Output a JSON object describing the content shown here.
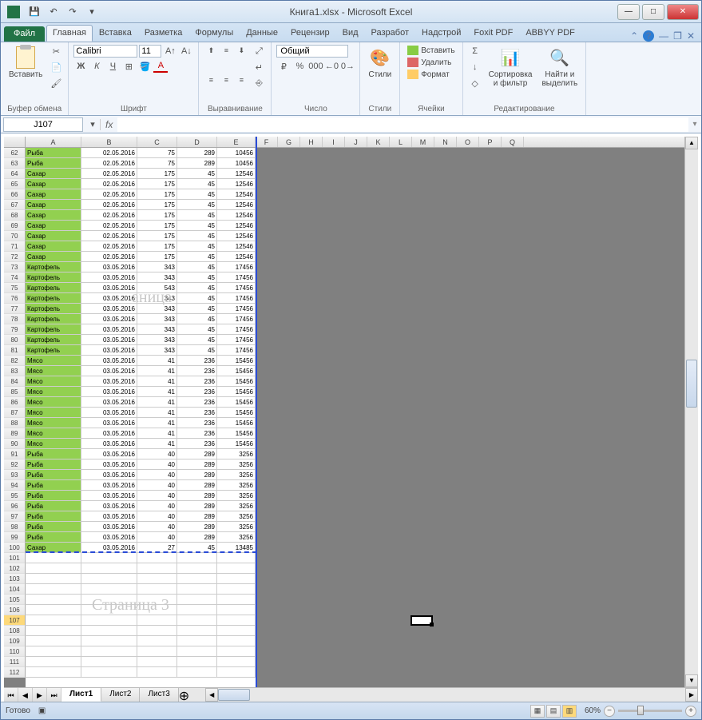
{
  "title": "Книга1.xlsx - Microsoft Excel",
  "qat": {
    "save": "💾",
    "undo": "↶",
    "redo": "↷",
    "more": "▾"
  },
  "win": {
    "min": "—",
    "max": "□",
    "close": "✕"
  },
  "tabs": {
    "file": "Файл",
    "list": [
      "Главная",
      "Вставка",
      "Разметка",
      "Формулы",
      "Данные",
      "Рецензир",
      "Вид",
      "Разработ",
      "Надстрой",
      "Foxit PDF",
      "ABBYY PDF"
    ],
    "active": "Главная"
  },
  "ribbon": {
    "clipboard": {
      "label": "Буфер обмена",
      "paste": "Вставить",
      "cut": "✂",
      "copy": "📄",
      "brush": "🖌"
    },
    "font": {
      "label": "Шрифт",
      "name": "Calibri",
      "size": "11",
      "bold": "Ж",
      "italic": "К",
      "underline": "Ч",
      "border": "⊞",
      "fill": "🪣",
      "color": "A",
      "grow": "A↑",
      "shrink": "A↓"
    },
    "align": {
      "label": "Выравнивание",
      "wrap": "↵",
      "merge": "⎆"
    },
    "number": {
      "label": "Число",
      "format": "Общий",
      "currency": "₽",
      "percent": "%",
      "comma": "000",
      "inc": "←0",
      "dec": "0→"
    },
    "styles": {
      "label": "Стили",
      "btn": "Стили"
    },
    "cells": {
      "label": "Ячейки",
      "insert": "Вставить",
      "delete": "Удалить",
      "format": "Формат"
    },
    "editing": {
      "label": "Редактирование",
      "sum": "Σ",
      "fill": "↓",
      "clear": "◇",
      "sort": "Сортировка\nи фильтр",
      "find": "Найти и\nвыделить"
    }
  },
  "namebox": "J107",
  "fx": "fx",
  "columns": [
    "A",
    "B",
    "C",
    "D",
    "E",
    "F",
    "G",
    "H",
    "I",
    "J",
    "K",
    "L",
    "M",
    "N",
    "O",
    "P",
    "Q"
  ],
  "watermarks": {
    "p2": "аница",
    "p3": "Страница 3"
  },
  "data_rows": [
    {
      "r": 62,
      "a": "Рыба",
      "b": "02.05.2016",
      "c": 75,
      "d": 289,
      "e": 10456
    },
    {
      "r": 63,
      "a": "Рыба",
      "b": "02.05.2016",
      "c": 75,
      "d": 289,
      "e": 10456
    },
    {
      "r": 64,
      "a": "Сахар",
      "b": "02.05.2016",
      "c": 175,
      "d": 45,
      "e": 12546
    },
    {
      "r": 65,
      "a": "Сахар",
      "b": "02.05.2016",
      "c": 175,
      "d": 45,
      "e": 12546
    },
    {
      "r": 66,
      "a": "Сахар",
      "b": "02.05.2016",
      "c": 175,
      "d": 45,
      "e": 12546
    },
    {
      "r": 67,
      "a": "Сахар",
      "b": "02.05.2016",
      "c": 175,
      "d": 45,
      "e": 12546
    },
    {
      "r": 68,
      "a": "Сахар",
      "b": "02.05.2016",
      "c": 175,
      "d": 45,
      "e": 12546
    },
    {
      "r": 69,
      "a": "Сахар",
      "b": "02.05.2016",
      "c": 175,
      "d": 45,
      "e": 12546
    },
    {
      "r": 70,
      "a": "Сахар",
      "b": "02.05.2016",
      "c": 175,
      "d": 45,
      "e": 12546
    },
    {
      "r": 71,
      "a": "Сахар",
      "b": "02.05.2016",
      "c": 175,
      "d": 45,
      "e": 12546
    },
    {
      "r": 72,
      "a": "Сахар",
      "b": "02.05.2016",
      "c": 175,
      "d": 45,
      "e": 12546
    },
    {
      "r": 73,
      "a": "Картофель",
      "b": "03.05.2016",
      "c": 343,
      "d": 45,
      "e": 17456
    },
    {
      "r": 74,
      "a": "Картофель",
      "b": "03.05.2016",
      "c": 343,
      "d": 45,
      "e": 17456
    },
    {
      "r": 75,
      "a": "Картофель",
      "b": "03.05.2016",
      "c": 543,
      "d": 45,
      "e": 17456
    },
    {
      "r": 76,
      "a": "Картофель",
      "b": "03.05.2016",
      "c": 343,
      "d": 45,
      "e": 17456
    },
    {
      "r": 77,
      "a": "Картофель",
      "b": "03.05.2016",
      "c": 343,
      "d": 45,
      "e": 17456
    },
    {
      "r": 78,
      "a": "Картофель",
      "b": "03.05.2016",
      "c": 343,
      "d": 45,
      "e": 17456
    },
    {
      "r": 79,
      "a": "Картофель",
      "b": "03.05.2016",
      "c": 343,
      "d": 45,
      "e": 17456
    },
    {
      "r": 80,
      "a": "Картофель",
      "b": "03.05.2016",
      "c": 343,
      "d": 45,
      "e": 17456
    },
    {
      "r": 81,
      "a": "Картофель",
      "b": "03.05.2016",
      "c": 343,
      "d": 45,
      "e": 17456
    },
    {
      "r": 82,
      "a": "Мясо",
      "b": "03.05.2016",
      "c": 41,
      "d": 236,
      "e": 15456
    },
    {
      "r": 83,
      "a": "Мясо",
      "b": "03.05.2016",
      "c": 41,
      "d": 236,
      "e": 15456
    },
    {
      "r": 84,
      "a": "Мясо",
      "b": "03.05.2016",
      "c": 41,
      "d": 236,
      "e": 15456
    },
    {
      "r": 85,
      "a": "Мясо",
      "b": "03.05.2016",
      "c": 41,
      "d": 236,
      "e": 15456
    },
    {
      "r": 86,
      "a": "Мясо",
      "b": "03.05.2016",
      "c": 41,
      "d": 236,
      "e": 15456
    },
    {
      "r": 87,
      "a": "Мясо",
      "b": "03.05.2016",
      "c": 41,
      "d": 236,
      "e": 15456
    },
    {
      "r": 88,
      "a": "Мясо",
      "b": "03.05.2016",
      "c": 41,
      "d": 236,
      "e": 15456
    },
    {
      "r": 89,
      "a": "Мясо",
      "b": "03.05.2016",
      "c": 41,
      "d": 236,
      "e": 15456
    },
    {
      "r": 90,
      "a": "Мясо",
      "b": "03.05.2016",
      "c": 41,
      "d": 236,
      "e": 15456
    },
    {
      "r": 91,
      "a": "Рыба",
      "b": "03.05.2016",
      "c": 40,
      "d": 289,
      "e": 3256
    },
    {
      "r": 92,
      "a": "Рыба",
      "b": "03.05.2016",
      "c": 40,
      "d": 289,
      "e": 3256
    },
    {
      "r": 93,
      "a": "Рыба",
      "b": "03.05.2016",
      "c": 40,
      "d": 289,
      "e": 3256
    },
    {
      "r": 94,
      "a": "Рыба",
      "b": "03.05.2016",
      "c": 40,
      "d": 289,
      "e": 3256
    },
    {
      "r": 95,
      "a": "Рыба",
      "b": "03.05.2016",
      "c": 40,
      "d": 289,
      "e": 3256
    },
    {
      "r": 96,
      "a": "Рыба",
      "b": "03.05.2016",
      "c": 40,
      "d": 289,
      "e": 3256
    },
    {
      "r": 97,
      "a": "Рыба",
      "b": "03.05.2016",
      "c": 40,
      "d": 289,
      "e": 3256
    },
    {
      "r": 98,
      "a": "Рыба",
      "b": "03.05.2016",
      "c": 40,
      "d": 289,
      "e": 3256
    },
    {
      "r": 99,
      "a": "Рыба",
      "b": "03.05.2016",
      "c": 40,
      "d": 289,
      "e": 3256
    },
    {
      "r": 100,
      "a": "Сахар",
      "b": "03.05.2016",
      "c": 27,
      "d": 45,
      "e": 13485
    }
  ],
  "empty_rows": [
    101,
    102,
    103,
    104,
    105,
    106,
    107,
    108,
    109,
    110,
    111,
    112
  ],
  "selected_row": 107,
  "sheets": {
    "list": [
      "Лист1",
      "Лист2",
      "Лист3"
    ],
    "active": "Лист1",
    "add": "⊕"
  },
  "status": {
    "ready": "Готово",
    "zoom": "60%"
  }
}
